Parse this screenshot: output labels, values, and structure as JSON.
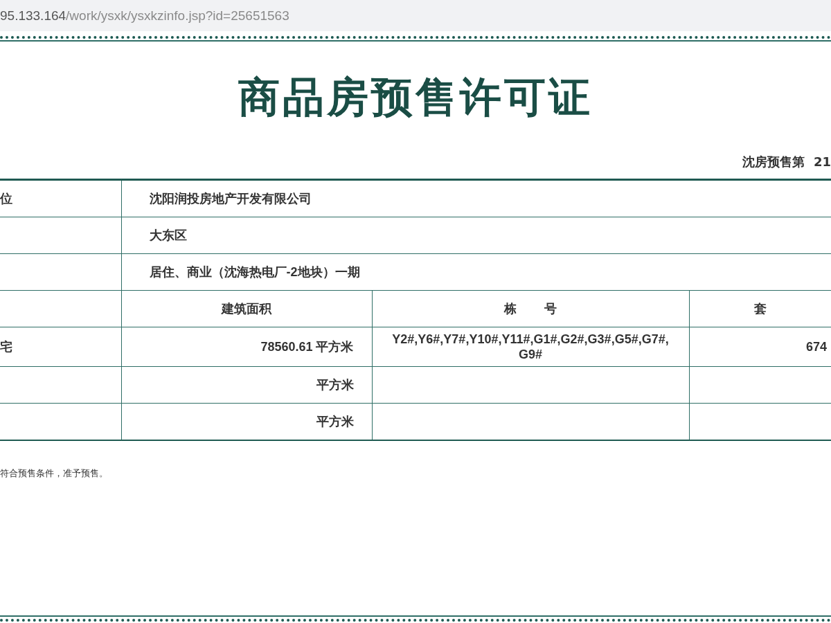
{
  "address_bar": {
    "host": "95.133.164",
    "path": "/work/ysxk/ysxkzinfo.jsp?id=25651563"
  },
  "title": "商品房预售许可证",
  "permit_number": "沈房预售第  21",
  "info_rows": [
    {
      "label": "位",
      "value": "沈阳润投房地产开发有限公司"
    },
    {
      "label": "",
      "value": "大东区"
    },
    {
      "label": "",
      "value": "居住、商业（沈海热电厂-2地块）一期"
    }
  ],
  "area_table": {
    "columns": [
      "",
      "建筑面积",
      "栋        号",
      "套"
    ],
    "rows": [
      {
        "use": "宅",
        "area": "78560.61 平方米",
        "buildings": "Y2#,Y6#,Y7#,Y10#,Y11#,G1#,G2#,G3#,G5#,G7#,G9#",
        "units": "674"
      },
      {
        "use": "",
        "area": "平方米",
        "buildings": "",
        "units": ""
      },
      {
        "use": "",
        "area": "平方米",
        "buildings": "",
        "units": ""
      }
    ]
  },
  "note": "符合预售条件，准予预售。"
}
